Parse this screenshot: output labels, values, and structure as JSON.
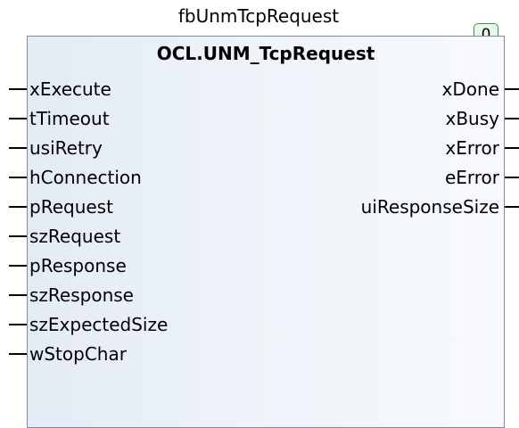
{
  "instance_name": "fbUnmTcpRequest",
  "block_type": "OCL.UNM_TcpRequest",
  "execution_order": "0",
  "inputs": [
    "xExecute",
    "tTimeout",
    "usiRetry",
    "hConnection",
    "pRequest",
    "szRequest",
    "pResponse",
    "szResponse",
    "szExpectedSize",
    "wStopChar"
  ],
  "outputs": [
    "xDone",
    "xBusy",
    "xError",
    "eError",
    "uiResponseSize"
  ],
  "colors": {
    "block_border": "#7d8b9c",
    "block_fill": "#e3ebf5",
    "badge_border": "#3a9a3a",
    "badge_fill": "#eaf7ea"
  }
}
